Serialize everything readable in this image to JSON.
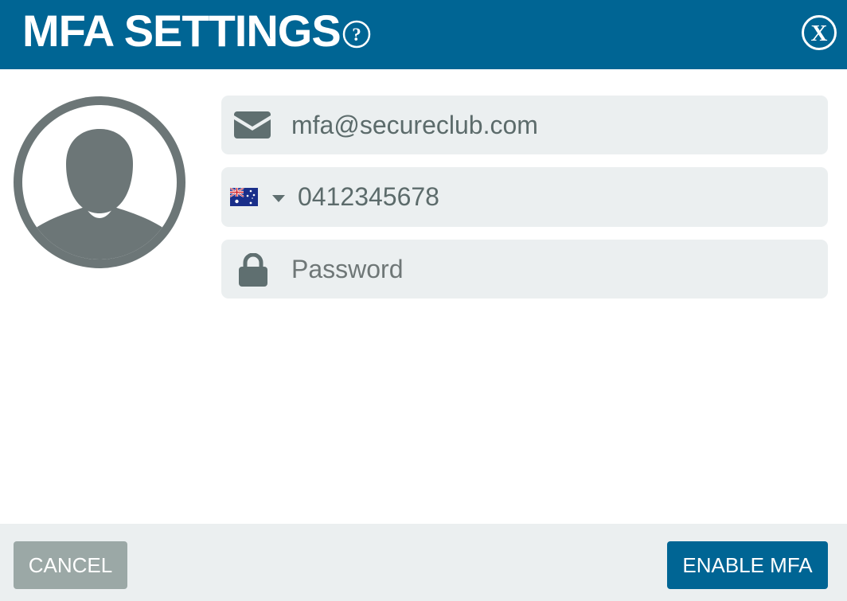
{
  "header": {
    "title": "MFA SETTINGS",
    "help_symbol": "?",
    "close_symbol": "X",
    "background_color": "#006594"
  },
  "form": {
    "email": {
      "value": "mfa@secureclub.com",
      "icon": "envelope-icon"
    },
    "phone": {
      "value": "0412345678",
      "country_flag": "australia-flag-icon",
      "dropdown_icon": "caret-down-icon"
    },
    "password": {
      "value": "",
      "placeholder": "Password",
      "icon": "lock-icon"
    },
    "field_background": "#ebeff0",
    "text_color": "#5c6b6b"
  },
  "avatar": {
    "icon": "user-avatar-icon",
    "color": "#6c7677"
  },
  "footer": {
    "cancel_label": "CANCEL",
    "cancel_color": "#9ba8a6",
    "enable_label": "ENABLE MFA",
    "enable_color": "#006594"
  }
}
